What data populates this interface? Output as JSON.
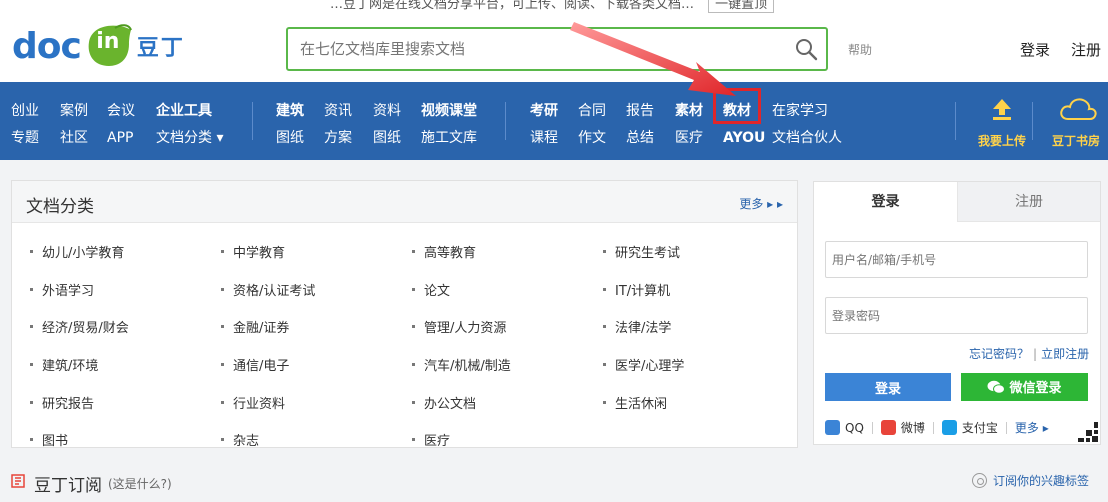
{
  "header": {
    "top_strip_text": "…豆丁网是在线文档分享平台，可上传、阅读、下载各类文档…",
    "top_strip_box": "一键置顶",
    "logo_text": "doc",
    "logo_in": "in",
    "logo_cn": "豆丁",
    "search_placeholder": "在七亿文档库里搜索文档",
    "help": "帮助",
    "login": "登录",
    "register": "注册"
  },
  "nav": {
    "row1": [
      {
        "label": "创业",
        "bold": false
      },
      {
        "label": "案例",
        "bold": false
      },
      {
        "label": "会议",
        "bold": false
      },
      {
        "label": "企业工具",
        "bold": true
      },
      {
        "label": "建筑",
        "bold": true
      },
      {
        "label": "资讯",
        "bold": false
      },
      {
        "label": "资料",
        "bold": false
      },
      {
        "label": "视频课堂",
        "bold": true
      },
      {
        "label": "考研",
        "bold": true
      },
      {
        "label": "合同",
        "bold": false
      },
      {
        "label": "报告",
        "bold": false
      },
      {
        "label": "素材",
        "bold": true
      },
      {
        "label": "教材",
        "bold": true
      },
      {
        "label": "在家学习",
        "bold": false
      }
    ],
    "row2": [
      {
        "label": "专题",
        "bold": false
      },
      {
        "label": "社区",
        "bold": false
      },
      {
        "label": "APP",
        "bold": false
      },
      {
        "label": "文档分类 ▾",
        "bold": false
      },
      {
        "label": "图纸",
        "bold": false
      },
      {
        "label": "方案",
        "bold": false
      },
      {
        "label": "图纸",
        "bold": false
      },
      {
        "label": "施工文库",
        "bold": false
      },
      {
        "label": "课程",
        "bold": false
      },
      {
        "label": "作文",
        "bold": false
      },
      {
        "label": "总结",
        "bold": false
      },
      {
        "label": "医疗",
        "bold": false
      },
      {
        "label": "AYOU",
        "bold": true
      },
      {
        "label": "文档合伙人",
        "bold": false
      }
    ],
    "upload_label": "我要上传",
    "bookstore_label": "豆丁书房"
  },
  "categories": {
    "title": "文档分类",
    "more": "更多 ▸ ▸",
    "items": [
      "幼儿/小学教育",
      "中学教育",
      "高等教育",
      "研究生考试",
      "外语学习",
      "资格/认证考试",
      "论文",
      "IT/计算机",
      "经济/贸易/财会",
      "金融/证券",
      "管理/人力资源",
      "法律/法学",
      "建筑/环境",
      "通信/电子",
      "汽车/机械/制造",
      "医学/心理学",
      "研究报告",
      "行业资料",
      "办公文档",
      "生活休闲",
      "图书",
      "杂志",
      "医疗"
    ]
  },
  "login_panel": {
    "tab_login": "登录",
    "tab_register": "注册",
    "username_placeholder": "用户名/邮箱/手机号",
    "password_placeholder": "登录密码",
    "forgot": "忘记密码？",
    "quick_register": "立即注册",
    "login_button": "登录",
    "wechat_button": "微信登录",
    "social": {
      "qq": "QQ",
      "weibo": "微博",
      "alipay": "支付宝",
      "more": "更多 ▸"
    }
  },
  "subscription": {
    "title": "豆丁订阅",
    "note": "(这是什么?)",
    "right_link": "订阅你的兴趣标签"
  }
}
